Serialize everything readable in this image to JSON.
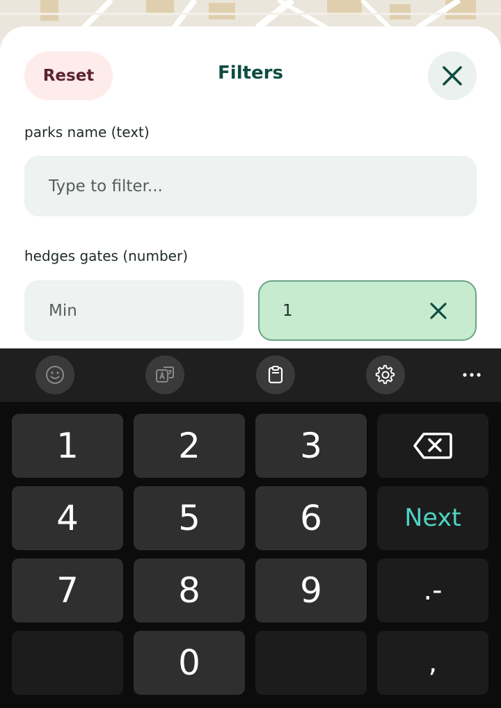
{
  "sheet": {
    "title": "Filters",
    "reset_label": "Reset"
  },
  "filters": {
    "parks_label": "parks name (text)",
    "parks_placeholder": "Type to filter...",
    "hedges_label": "hedges gates (number)",
    "hedges_min_placeholder": "Min",
    "hedges_max_value": "1"
  },
  "keyboard": {
    "toolbar_icons": [
      "emoji-icon",
      "translate-icon",
      "clipboard-icon",
      "settings-icon",
      "more-icon"
    ],
    "keys": {
      "k1": "1",
      "k2": "2",
      "k3": "3",
      "k4": "4",
      "k5": "5",
      "k6": "6",
      "k7": "7",
      "k8": "8",
      "k9": "9",
      "k0": "0",
      "next": "Next",
      "dot_minus": ".-",
      "comma": ","
    },
    "accent_color": "#4fd3c3"
  }
}
